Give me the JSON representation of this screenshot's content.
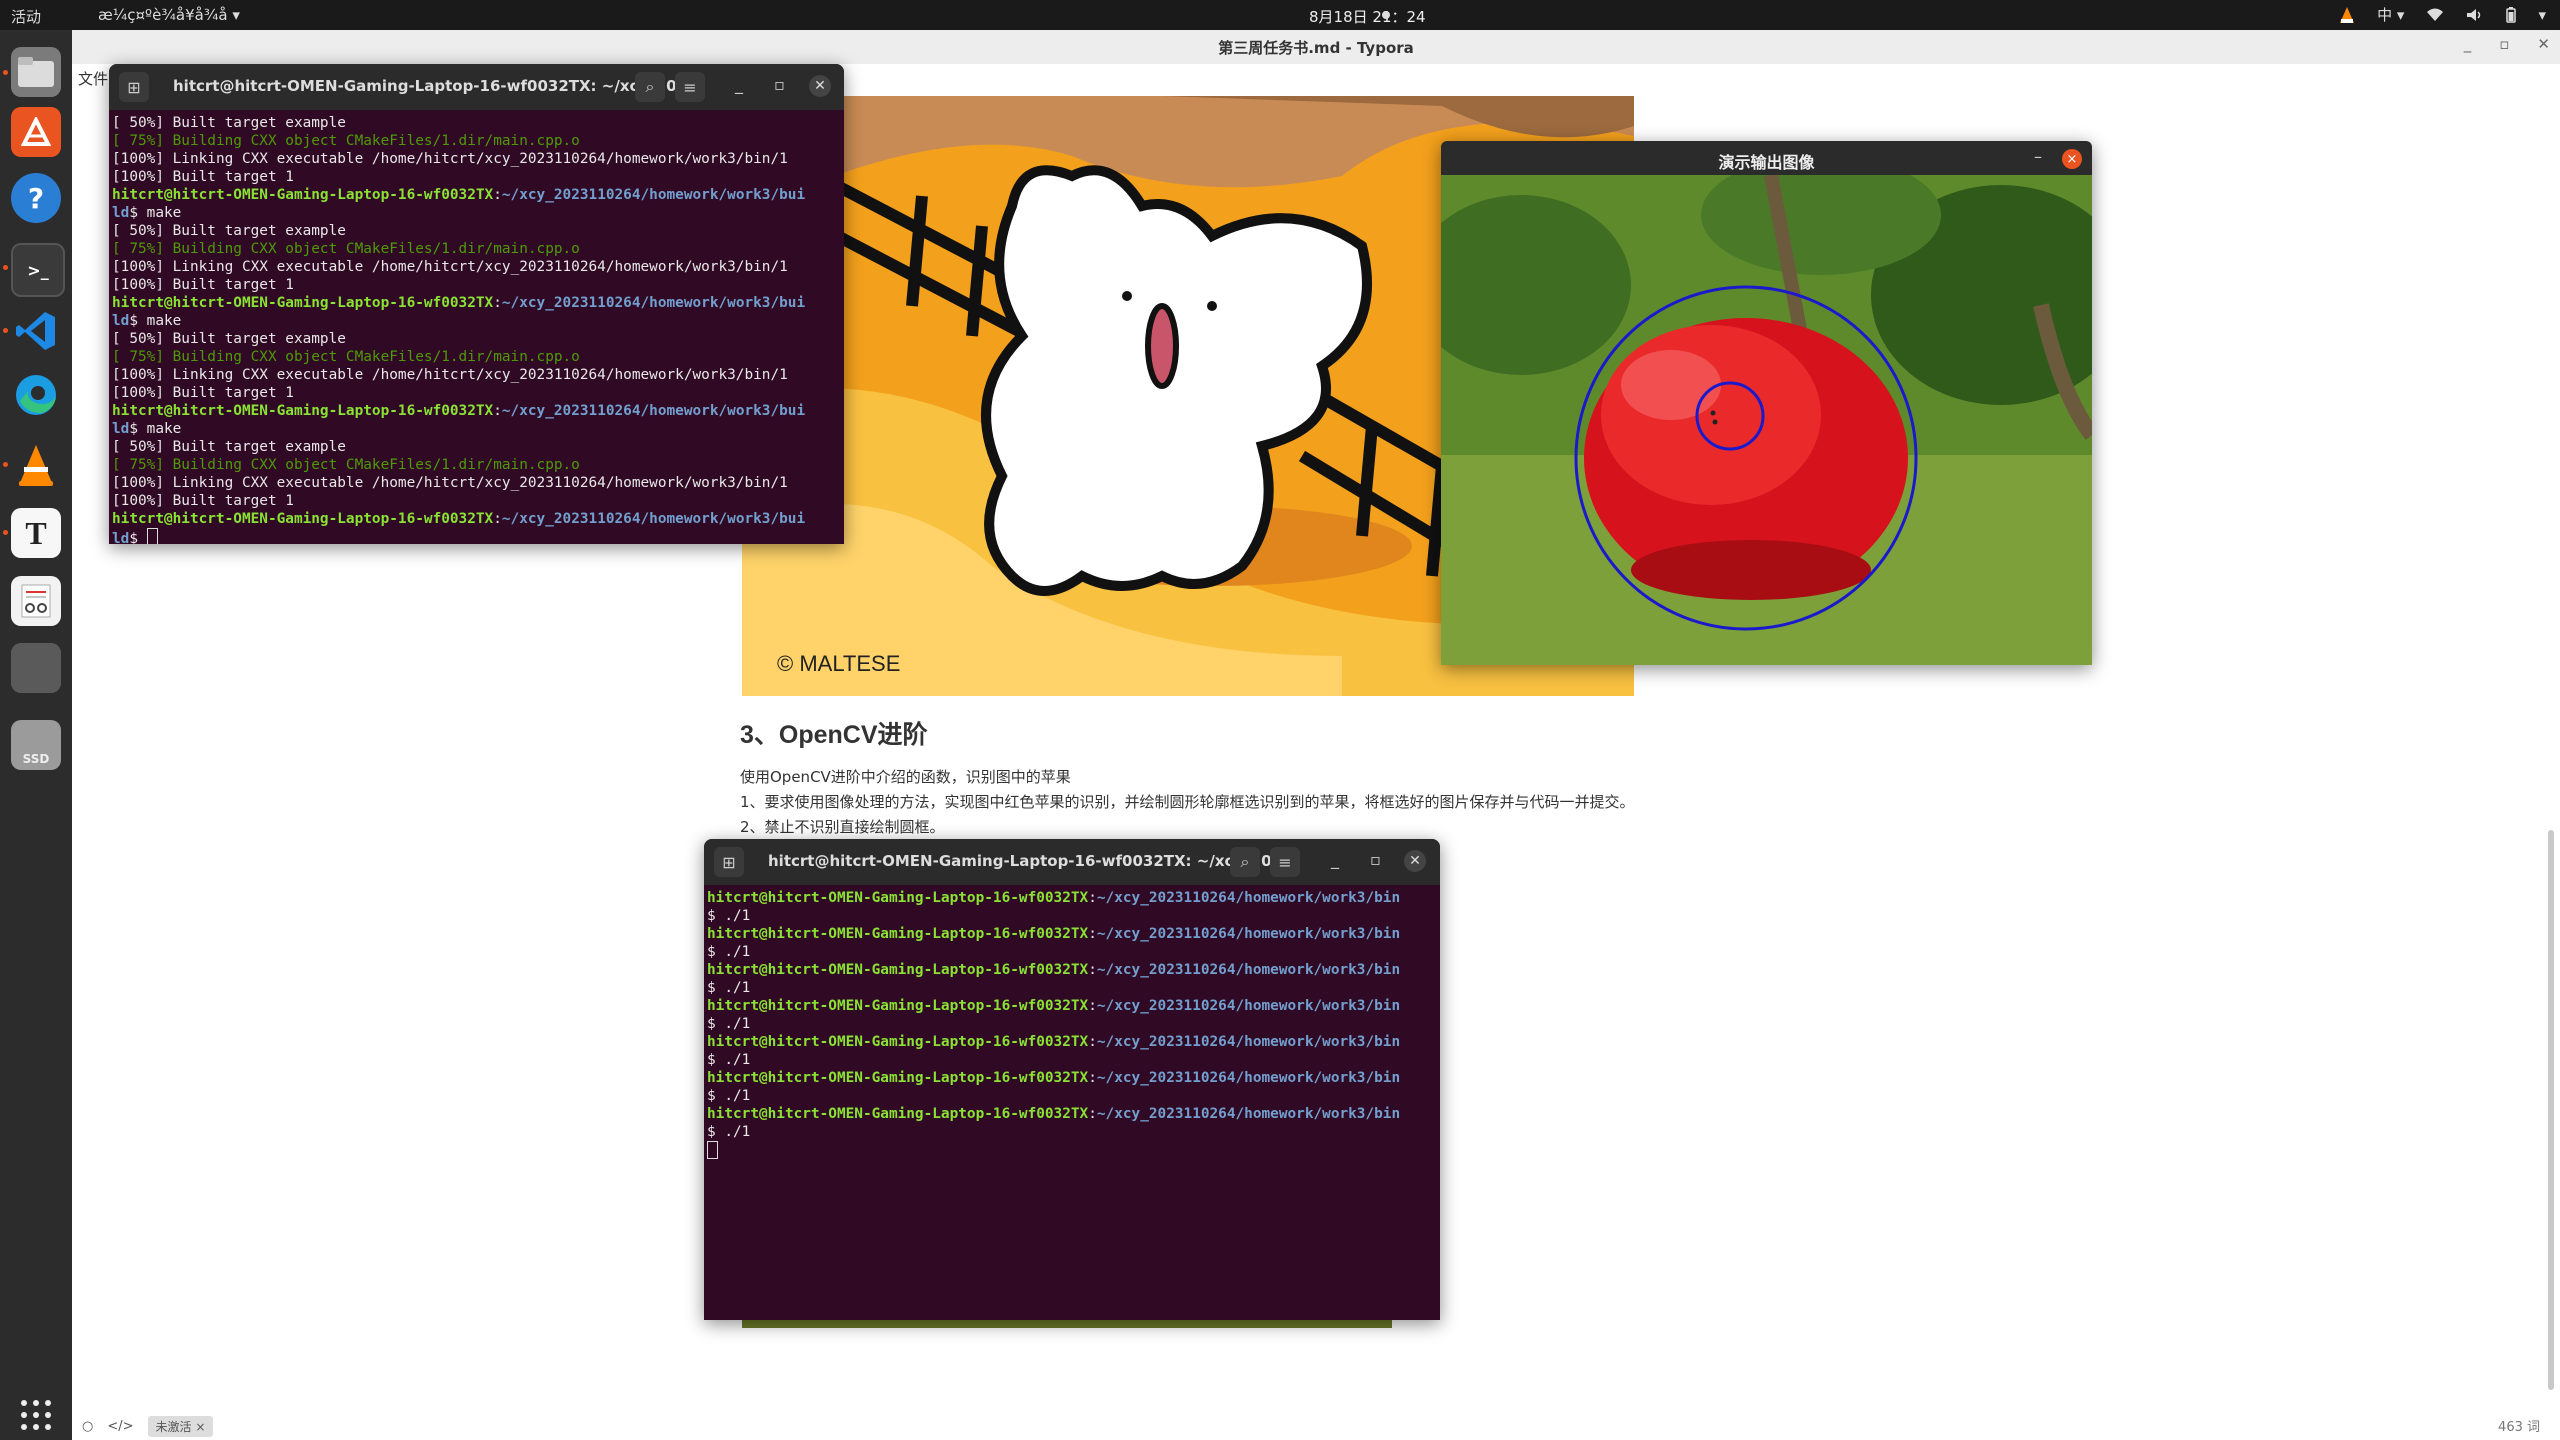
{
  "topbar": {
    "activities": "活动",
    "app_menu": "æ¼ç¤ºè¾å¥å¾å",
    "clock": "8月18日  21：24",
    "input_method": "中",
    "chevron": "▾"
  },
  "dock": {
    "items": [
      "files",
      "app-center",
      "help",
      "terminal",
      "vscode",
      "edge",
      "vlc",
      "typora",
      "text-editor",
      "blank",
      "ssd"
    ],
    "ssd_label": "SSD",
    "typora_glyph": "T",
    "terminal_glyph": ">_"
  },
  "typora": {
    "window_title": "第三周任务书.md - Typora",
    "menu_file": "文件",
    "image_watermark": "© MALTESE",
    "heading": "3、OpenCV进阶",
    "paragraphs": [
      "使用OpenCV进阶中介绍的函数，识别图中的苹果",
      "1、要求使用图像处理的方法，实现图中红色苹果的识别，并绘制圆形轮廓框选识别到的苹果，将框选好的图片保存并与代码一并提交。",
      "2、禁止不识别直接绘制圆框。"
    ],
    "status_badge": "未激活 ×",
    "word_count": "463 词",
    "status_icons": [
      "○",
      "</>"
    ]
  },
  "terminal1": {
    "title": "hitcrt@hitcrt-OMEN-Gaming-Laptop-16-wf0032TX: ~/xcy_202...",
    "prompt_user": "hitcrt@hitcrt-OMEN-Gaming-Laptop-16-wf0032TX",
    "prompt_path": "~/xcy_2023110264/homework/work3/bui",
    "prompt_path_wrap": "ld",
    "command": "make",
    "line_built_example": "[ 50%] Built target example",
    "line_building": "[ 75%] Building CXX object CMakeFiles/1.dir/main.cpp.o",
    "line_linking": "[100%] Linking CXX executable /home/hitcrt/xcy_2023110264/homework/work3/bin/1",
    "line_built_1": "[100%] Built target 1"
  },
  "terminal2": {
    "title": "hitcrt@hitcrt-OMEN-Gaming-Laptop-16-wf0032TX: ~/xcy_202...",
    "prompt_user": "hitcrt@hitcrt-OMEN-Gaming-Laptop-16-wf0032TX",
    "prompt_path": "~/xcy_2023110264/homework/work3/bin",
    "command": "$ ./1",
    "repeat": 7
  },
  "cv_window": {
    "title": "演示输出图像",
    "min": "–",
    "close": "×"
  },
  "colors": {
    "terminal_bg": "#300a24",
    "prompt_green": "#8ae234",
    "prompt_blue": "#729fcf",
    "build_green": "#4e9a06",
    "ubuntu_orange": "#e95420",
    "circle_blue": "#1a1acc"
  }
}
